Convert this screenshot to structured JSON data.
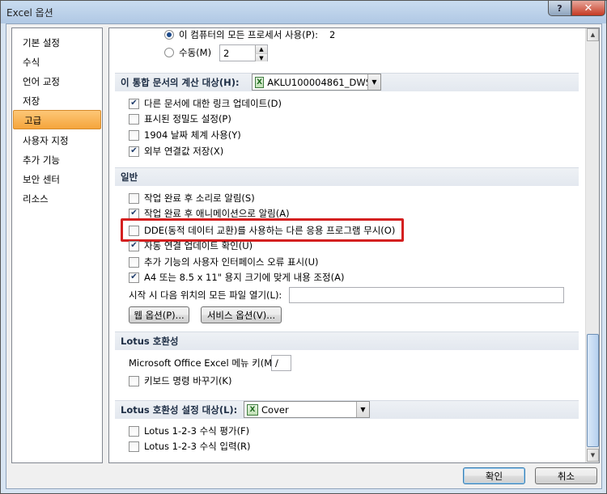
{
  "window": {
    "title": "Excel 옵션",
    "help": "?",
    "close": "✕"
  },
  "nav": {
    "items": [
      "기본 설정",
      "수식",
      "언어 교정",
      "저장",
      "고급",
      "사용자 지정",
      "추가 기능",
      "보안 센터",
      "리소스"
    ],
    "selected": "고급"
  },
  "threads": {
    "all_label": "이 컴퓨터의 모든 프로세서 사용(P):",
    "all_value": "2",
    "manual_label": "수동(M)",
    "manual_value": "2"
  },
  "calc": {
    "header": "이 통합 문서의 계산 대상(H):",
    "workbook": "AKLU100004861_DWS...",
    "options": [
      {
        "label": "다른 문서에 대한 링크 업데이트(D)",
        "checked": true
      },
      {
        "label": "표시된 정밀도 설정(P)",
        "checked": false
      },
      {
        "label": "1904 날짜 체계 사용(Y)",
        "checked": false
      },
      {
        "label": "외부 연결값 저장(X)",
        "checked": true
      }
    ]
  },
  "general": {
    "header": "일반",
    "options": [
      {
        "label": "작업 완료 후 소리로 알림(S)",
        "checked": false
      },
      {
        "label": "작업 완료 후 애니메이션으로 알림(A)",
        "checked": true
      },
      {
        "label": "DDE(동적 데이터 교환)를 사용하는 다른 응용 프로그램 무시(O)",
        "checked": false
      },
      {
        "label": "자동 연결 업데이트 확인(U)",
        "checked": true
      },
      {
        "label": "추가 기능의 사용자 인터페이스 오류 표시(U)",
        "checked": false
      },
      {
        "label": "A4 또는 8.5 x 11\" 용지 크기에 맞게 내용 조정(A)",
        "checked": true
      }
    ],
    "startup_label": "시작 시 다음 위치의 모든 파일 열기(L):",
    "startup_value": "",
    "web_options": "웹 옵션(P)...",
    "service_options": "서비스 옵션(V)..."
  },
  "lotus": {
    "header": "Lotus 호환성",
    "menu_key_label": "Microsoft Office Excel 메뉴 키(M):",
    "menu_key_value": "/",
    "nav_keys": {
      "label": "키보드 명령 바꾸기(K)",
      "checked": false
    }
  },
  "lotus_settings": {
    "header": "Lotus 호환성 설정 대상(L):",
    "sheet": "Cover",
    "options": [
      {
        "label": "Lotus 1-2-3 수식 평가(F)",
        "checked": false
      },
      {
        "label": "Lotus 1-2-3 수식 입력(R)",
        "checked": false
      }
    ]
  },
  "footer": {
    "ok": "확인",
    "cancel": "취소"
  },
  "colors": {
    "selected_nav": "#f5a53c",
    "highlight_box": "#d42020"
  },
  "icons": {
    "checkmark": "✔",
    "radio_dot": "●",
    "dropdown": "▼",
    "excel_file": "excel-workbook-icon"
  }
}
